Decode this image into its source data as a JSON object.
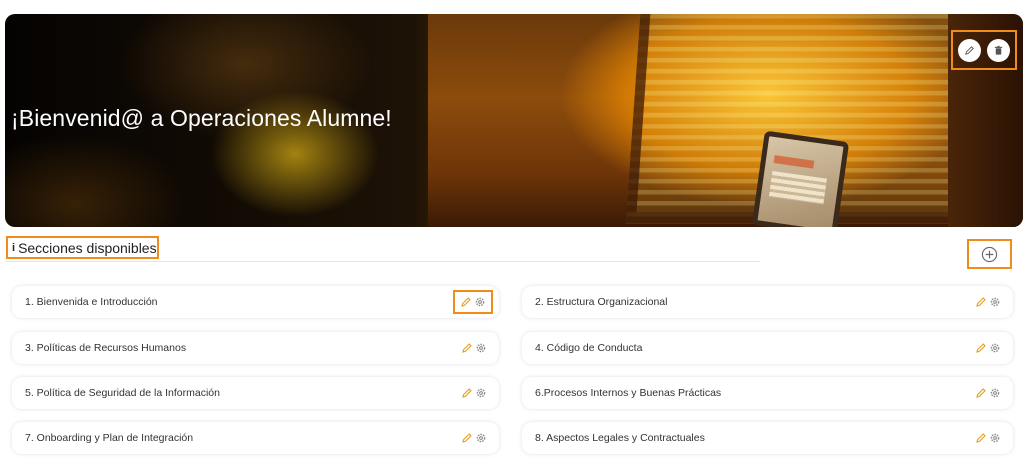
{
  "hero": {
    "title": "¡Bienvenid@ a Operaciones Alumne!"
  },
  "sections": {
    "title": "Secciones disponibles",
    "info_glyph": "i",
    "items": [
      {
        "label": "1. Bienvenida e Introducción"
      },
      {
        "label": "2. Estructura Organizacional"
      },
      {
        "label": "3. Políticas de Recursos Humanos"
      },
      {
        "label": "4. Código de Conducta"
      },
      {
        "label": "5. Política de Seguridad de la Información"
      },
      {
        "label": "6.Procesos Internos y Buenas Prácticas"
      },
      {
        "label": "7. Onboarding y Plan de Integración"
      },
      {
        "label": "8. Aspectos Legales y Contractuales"
      }
    ]
  },
  "icons": {
    "edit": "pencil-icon",
    "delete": "trash-icon",
    "settings": "gear-icon",
    "add": "plus-circle-icon"
  },
  "colors": {
    "highlight": "#f08c1a",
    "pencil": "#e0a020",
    "gear": "#888888"
  }
}
